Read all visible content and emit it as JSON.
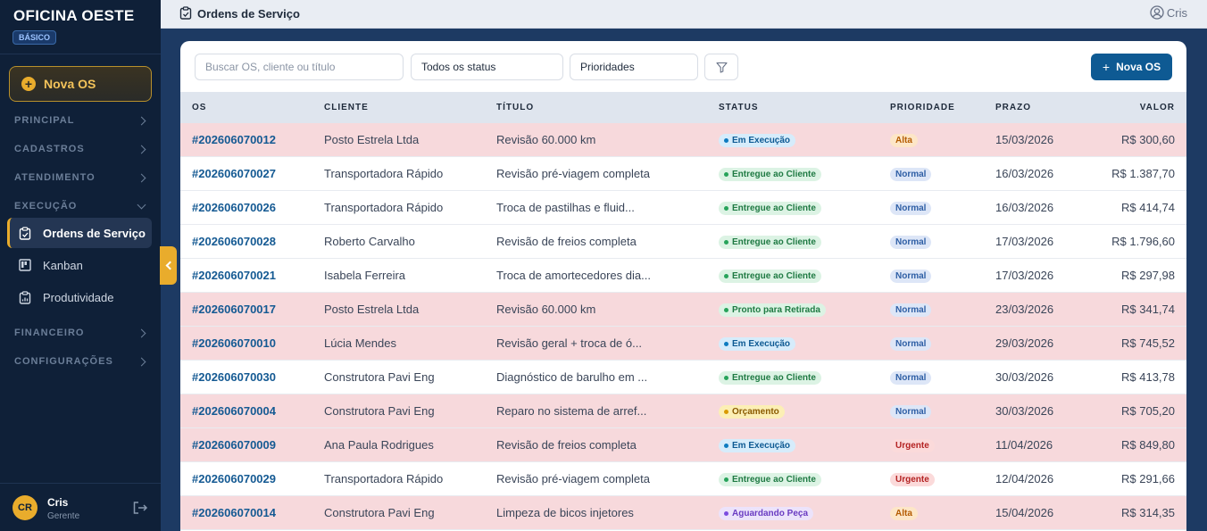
{
  "sidebar": {
    "brand": "OFICINA OESTE",
    "plan": "BÁSICO",
    "new_os_label": "Nova OS",
    "sections": {
      "principal": "PRINCIPAL",
      "cadastros": "CADASTROS",
      "atendimento": "ATENDIMENTO",
      "execucao": "EXECUÇÃO",
      "financeiro": "FINANCEIRO",
      "configuracoes": "CONFIGURAÇÕES"
    },
    "items": {
      "ordens": "Ordens de Serviço",
      "kanban": "Kanban",
      "produtividade": "Produtividade"
    },
    "user": {
      "initials": "CR",
      "name": "Cris",
      "role": "Gerente"
    }
  },
  "header": {
    "title": "Ordens de Serviço",
    "user": "Cris"
  },
  "filters": {
    "search_placeholder": "Buscar OS, cliente ou título",
    "status": "Todos os status",
    "priority": "Prioridades",
    "new_button": "Nova OS"
  },
  "table": {
    "columns": {
      "os": "OS",
      "cliente": "CLIENTE",
      "titulo": "TÍTULO",
      "status": "STATUS",
      "prioridade": "PRIORIDADE",
      "prazo": "PRAZO",
      "valor": "VALOR"
    },
    "rows": [
      {
        "os": "#202606070012",
        "cliente": "Posto Estrela Ltda",
        "titulo": "Revisão 60.000 km",
        "status": "Em Execução",
        "prioridade": "Alta",
        "prazo": "15/03/2026",
        "valor": "R$ 300,60"
      },
      {
        "os": "#202606070027",
        "cliente": "Transportadora Rápido",
        "titulo": "Revisão pré-viagem completa",
        "status": "Entregue ao Cliente",
        "prioridade": "Normal",
        "prazo": "16/03/2026",
        "valor": "R$ 1.387,70"
      },
      {
        "os": "#202606070026",
        "cliente": "Transportadora Rápido",
        "titulo": "Troca de pastilhas e fluid...",
        "status": "Entregue ao Cliente",
        "prioridade": "Normal",
        "prazo": "16/03/2026",
        "valor": "R$ 414,74"
      },
      {
        "os": "#202606070028",
        "cliente": "Roberto Carvalho",
        "titulo": "Revisão de freios completa",
        "status": "Entregue ao Cliente",
        "prioridade": "Normal",
        "prazo": "17/03/2026",
        "valor": "R$ 1.796,60"
      },
      {
        "os": "#202606070021",
        "cliente": "Isabela Ferreira",
        "titulo": "Troca de amortecedores dia...",
        "status": "Entregue ao Cliente",
        "prioridade": "Normal",
        "prazo": "17/03/2026",
        "valor": "R$ 297,98"
      },
      {
        "os": "#202606070017",
        "cliente": "Posto Estrela Ltda",
        "titulo": "Revisão 60.000 km",
        "status": "Pronto para Retirada",
        "prioridade": "Normal",
        "prazo": "23/03/2026",
        "valor": "R$ 341,74"
      },
      {
        "os": "#202606070010",
        "cliente": "Lúcia Mendes",
        "titulo": "Revisão geral + troca de ó...",
        "status": "Em Execução",
        "prioridade": "Normal",
        "prazo": "29/03/2026",
        "valor": "R$ 745,52"
      },
      {
        "os": "#202606070030",
        "cliente": "Construtora Pavi Eng",
        "titulo": "Diagnóstico de barulho em ...",
        "status": "Entregue ao Cliente",
        "prioridade": "Normal",
        "prazo": "30/03/2026",
        "valor": "R$ 413,78"
      },
      {
        "os": "#202606070004",
        "cliente": "Construtora Pavi Eng",
        "titulo": "Reparo no sistema de arref...",
        "status": "Orçamento",
        "prioridade": "Normal",
        "prazo": "30/03/2026",
        "valor": "R$ 705,20"
      },
      {
        "os": "#202606070009",
        "cliente": "Ana Paula Rodrigues",
        "titulo": "Revisão de freios completa",
        "status": "Em Execução",
        "prioridade": "Urgente",
        "prazo": "11/04/2026",
        "valor": "R$ 849,80"
      },
      {
        "os": "#202606070029",
        "cliente": "Transportadora Rápido",
        "titulo": "Revisão pré-viagem completa",
        "status": "Entregue ao Cliente",
        "prioridade": "Urgente",
        "prazo": "12/04/2026",
        "valor": "R$ 291,66"
      },
      {
        "os": "#202606070014",
        "cliente": "Construtora Pavi Eng",
        "titulo": "Limpeza de bicos injetores",
        "status": "Aguardando Peça",
        "prioridade": "Alta",
        "prazo": "15/04/2026",
        "valor": "R$ 314,35"
      }
    ]
  },
  "colors": {
    "accent": "#e9ac2c",
    "primary": "#0e5a93",
    "late_row": "#f7d9dc"
  }
}
